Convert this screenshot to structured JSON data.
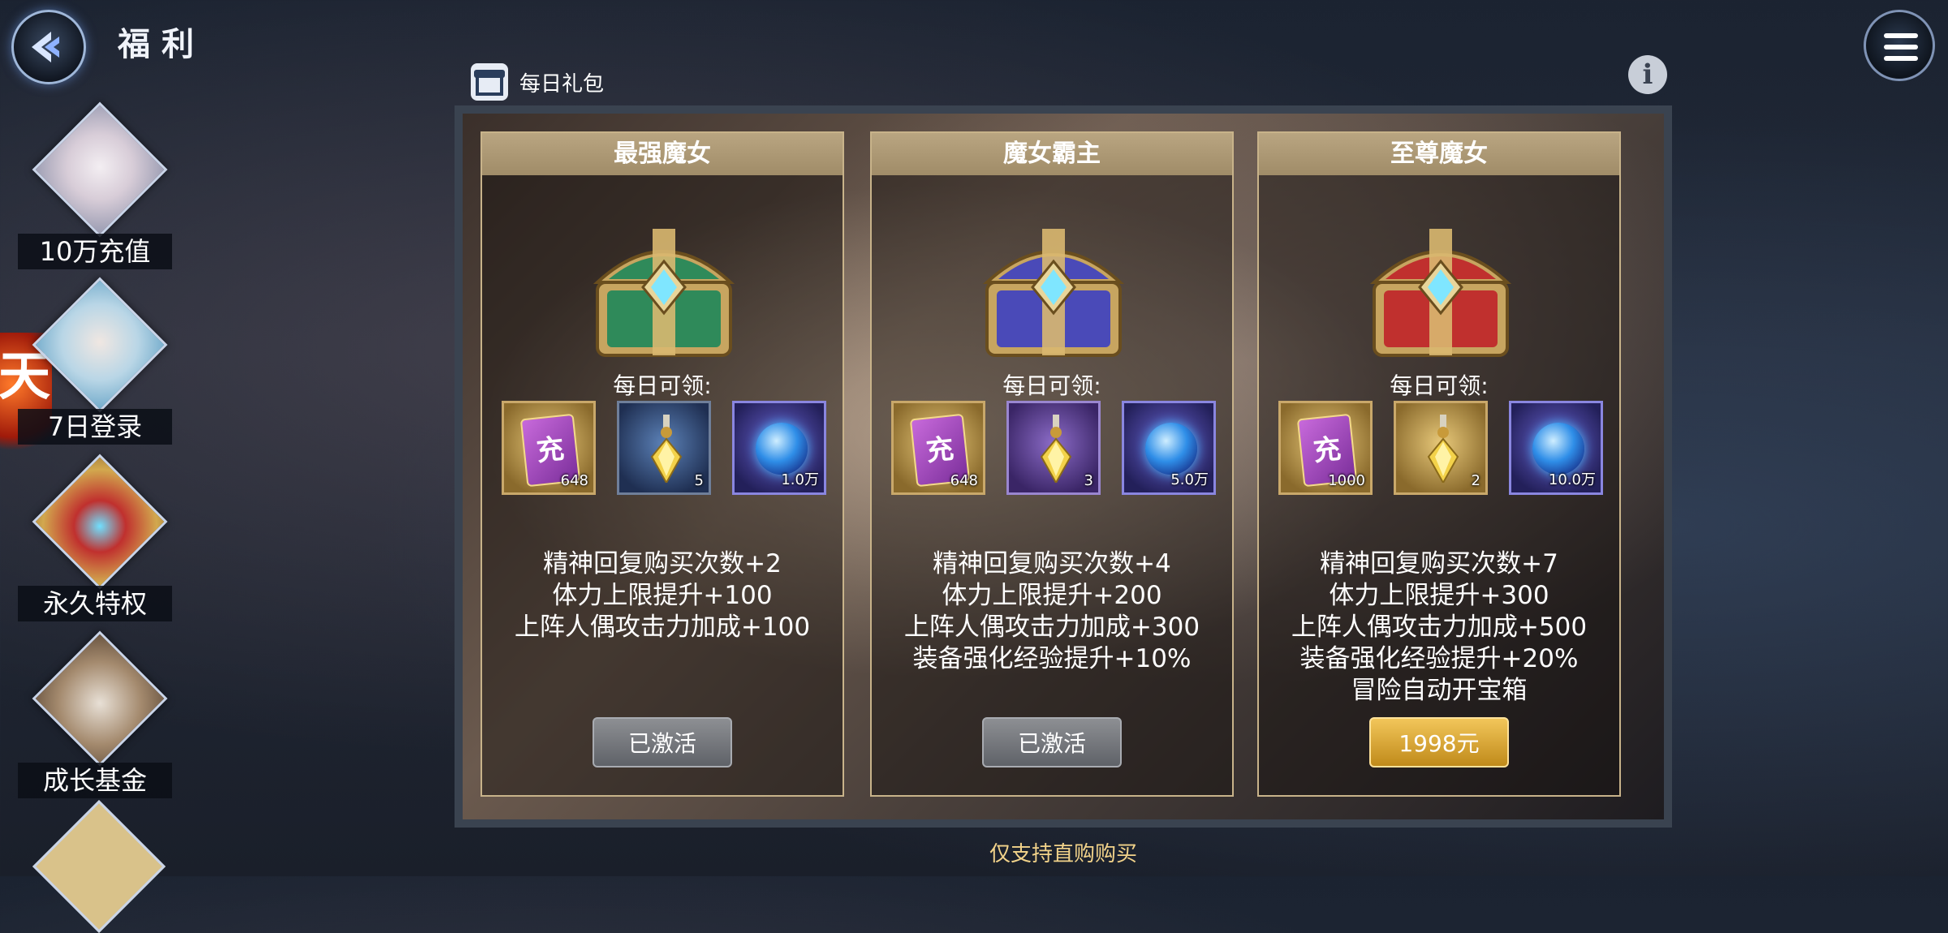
{
  "header": {
    "title": "福利"
  },
  "sidebar": {
    "items": [
      {
        "label": "10万充值"
      },
      {
        "label": "7日登录"
      },
      {
        "label": "永久特权"
      },
      {
        "label": "成长基金"
      }
    ],
    "badge_text": "天"
  },
  "panel": {
    "title": "每日礼包",
    "info_symbol": "i",
    "footer_note": "仅支持直购购买"
  },
  "cards": [
    {
      "name": "最强魔女",
      "chest_color": "#2f8a5a",
      "daily_label": "每日可领:",
      "items": [
        {
          "icon": "recharge-card-icon",
          "glyph": "充",
          "qty": "648"
        },
        {
          "icon": "crystal-pendant-icon",
          "qty": "5"
        },
        {
          "icon": "blue-orb-icon",
          "qty": "1.0万"
        }
      ],
      "perks": [
        "精神回复购买次数+2",
        "体力上限提升+100",
        "上阵人偶攻击力加成+100"
      ],
      "button": "已激活",
      "button_state": "activated"
    },
    {
      "name": "魔女霸主",
      "chest_color": "#4a4ab8",
      "daily_label": "每日可领:",
      "items": [
        {
          "icon": "recharge-card-icon",
          "glyph": "充",
          "qty": "648"
        },
        {
          "icon": "crystal-pendant-icon",
          "qty": "3"
        },
        {
          "icon": "blue-orb-icon",
          "qty": "5.0万"
        }
      ],
      "perks": [
        "精神回复购买次数+4",
        "体力上限提升+200",
        "上阵人偶攻击力加成+300",
        "装备强化经验提升+10%"
      ],
      "button": "已激活",
      "button_state": "activated"
    },
    {
      "name": "至尊魔女",
      "chest_color": "#c0302e",
      "daily_label": "每日可领:",
      "items": [
        {
          "icon": "recharge-card-icon",
          "glyph": "充",
          "qty": "1000"
        },
        {
          "icon": "crystal-pendant-icon",
          "qty": "2"
        },
        {
          "icon": "blue-orb-icon",
          "qty": "10.0万"
        }
      ],
      "perks": [
        "精神回复购买次数+7",
        "体力上限提升+300",
        "上阵人偶攻击力加成+500",
        "装备强化经验提升+20%",
        "冒险自动开宝箱"
      ],
      "button": "1998元",
      "button_state": "buy"
    }
  ]
}
